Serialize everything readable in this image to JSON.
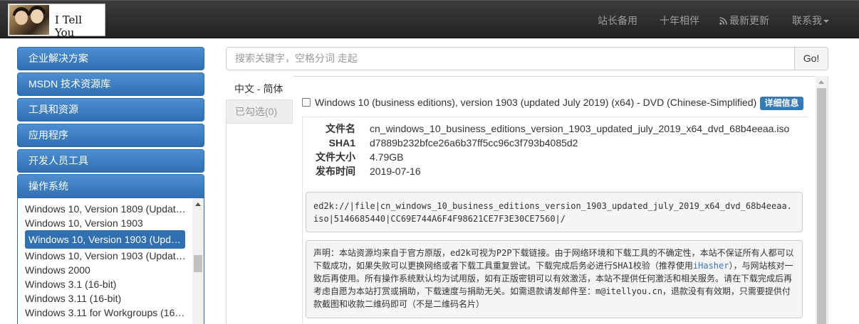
{
  "brand": {
    "name": "I Tell You",
    "logo_icon": "two-girls-photo-logo"
  },
  "nav": {
    "items": [
      "站长备用",
      "十年相伴",
      "最新更新",
      "联系我"
    ],
    "rss_icon": "rss-icon"
  },
  "sidebar": {
    "items": [
      "企业解决方案",
      "MSDN 技术资源库",
      "工具和资源",
      "应用程序",
      "开发人员工具",
      "操作系统"
    ],
    "os_list": [
      "Windows 10, Version 1809 (Updated…",
      "Windows 10, Version 1903",
      "Windows 10, Version 1903 (Updated…",
      "Windows 10, Version 1903 (Updated…",
      "Windows 2000",
      "Windows 3.1 (16-bit)",
      "Windows 3.11 (16-bit)",
      "Windows 3.11 for Workgroups (16-bi…"
    ],
    "selected_index": 2
  },
  "search": {
    "placeholder": "搜索关键字，空格分词 走起",
    "button": "Go!"
  },
  "tabs": {
    "active": "中文 - 简体",
    "inactive": "已勾选(0)"
  },
  "item": {
    "title": "Windows 10 (business editions), version 1903 (updated July 2019) (x64) - DVD (Chinese-Simplified)",
    "detail_button": "详细信息",
    "file_label": "文件名",
    "file_name": "cn_windows_10_business_editions_version_1903_updated_july_2019_x64_dvd_68b4eeaa.iso",
    "sha1_label": "SHA1",
    "sha1": "d7889b232bfce26a6b37ff5cc96c3f793b4085d2",
    "size_label": "文件大小",
    "size": "4.79GB",
    "date_label": "发布时间",
    "date": "2019-07-16",
    "ed2k": "ed2k://|file|cn_windows_10_business_editions_version_1903_updated_july_2019_x64_dvd_68b4eeaa.iso|5146685440|CC69E744A6F4F98621CE7F3E30CE7560|/"
  },
  "notice": {
    "part1": "声明：本站资源均来自于官方原版，ed2k可视为P2P下载链接。由于网络环境和下载工具的不确定性，本站不保证所有人都可以下载成功，如果失败可以更换网络或者下载工具重复尝试。下载完成后务必进行SHA1校验（推荐使用",
    "link": "iHasher",
    "part2": "），与网站核对一致后再使用。所有操作系统默认均为试用版，如有正版密钥可以有效激活，本站不提供任何激活和相关服务。请在下载完成后再考虑自愿为本站打赏或捐助，下载速度与捐助无关。如需退款请发邮件至：m@itellyou.cn，退款没有有效期，只需要提供付款截图和收款二维码即可（不是二维码名片）"
  }
}
